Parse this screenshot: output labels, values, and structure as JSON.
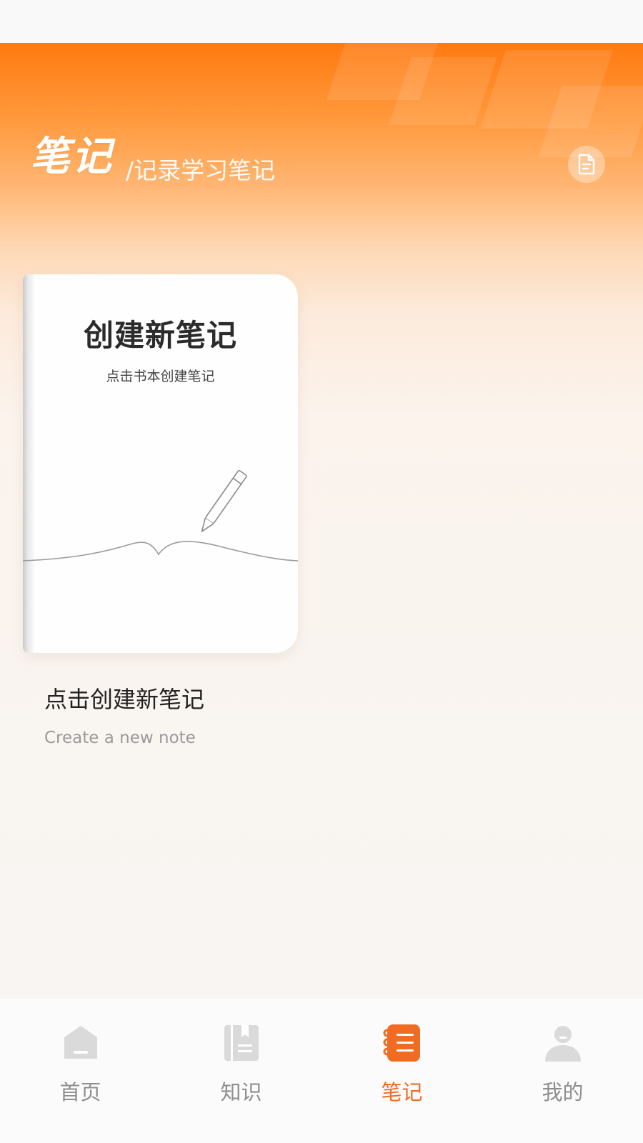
{
  "header": {
    "title": "笔记",
    "subtitle": "/记录学习笔记",
    "action_icon": "note-document-icon"
  },
  "notebook": {
    "title": "创建新笔记",
    "hint": "点击书本创建笔记",
    "illustration_icon": "pencil-writing-icon"
  },
  "create_prompt": {
    "title": "点击创建新笔记",
    "subtitle": "Create a new note"
  },
  "tabbar": {
    "active_color": "#f26b22",
    "inactive_color": "#8e8e8e",
    "tabs": [
      {
        "label": "首页",
        "icon": "home-icon",
        "active": false
      },
      {
        "label": "知识",
        "icon": "book-icon",
        "active": false
      },
      {
        "label": "笔记",
        "icon": "notebook-icon",
        "active": true
      },
      {
        "label": "我的",
        "icon": "user-icon",
        "active": false
      }
    ]
  },
  "colors": {
    "accent": "#ff7a10",
    "background": "#f9f3ee"
  }
}
